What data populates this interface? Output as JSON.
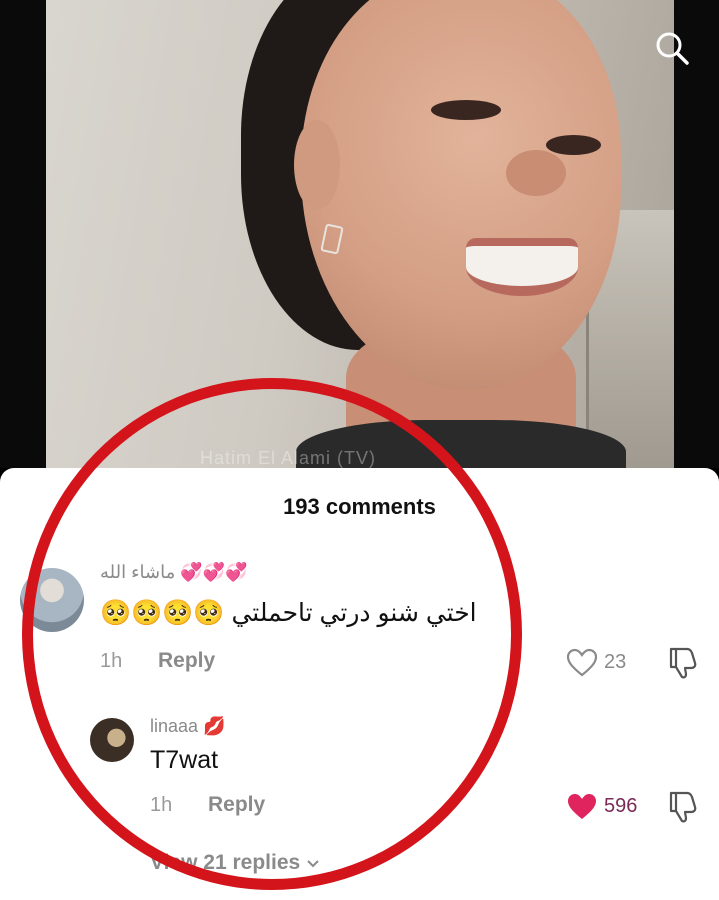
{
  "video": {
    "watermark": "Hatim El Alami (TV)",
    "search_icon": "search-icon"
  },
  "comments_panel": {
    "count_label": "193 comments",
    "comments": [
      {
        "username": "ماشاء الله",
        "username_emoji": "💞💞💞",
        "text": "اختي شنو درتي تاحملتي 🥺🥺🥺🥺",
        "time": "1h",
        "reply_label": "Reply",
        "likes": "23",
        "liked": false
      },
      {
        "username": "linaaa",
        "username_emoji": "💋",
        "text": "T7wat",
        "time": "1h",
        "reply_label": "Reply",
        "likes": "596",
        "liked": true
      }
    ],
    "view_replies_label": "View 21 replies",
    "view_replies_icon": "chevron-down-icon"
  },
  "colors": {
    "highlight_circle": "#d4141b",
    "liked_heart": "#e0245e"
  }
}
